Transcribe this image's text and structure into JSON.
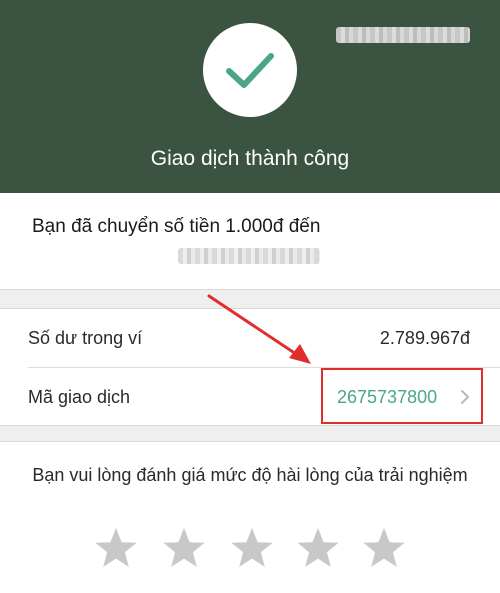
{
  "header": {
    "title": "Giao dịch thành công",
    "icon": "check-icon"
  },
  "message": {
    "text": "Bạn đã chuyển số tiền 1.000đ đến"
  },
  "details": {
    "balance_label": "Số dư trong ví",
    "balance_value": "2.789.967đ",
    "transaction_label": "Mã giao dịch",
    "transaction_value": "2675737800"
  },
  "rating": {
    "prompt": "Bạn vui lòng đánh giá mức độ hài lòng của trải nghiệm",
    "star_count": 5,
    "selected": 0
  },
  "colors": {
    "header_bg": "#3b5441",
    "accent": "#4aa689",
    "annotation": "#e02e2e",
    "star_inactive": "#c8c8c8"
  }
}
